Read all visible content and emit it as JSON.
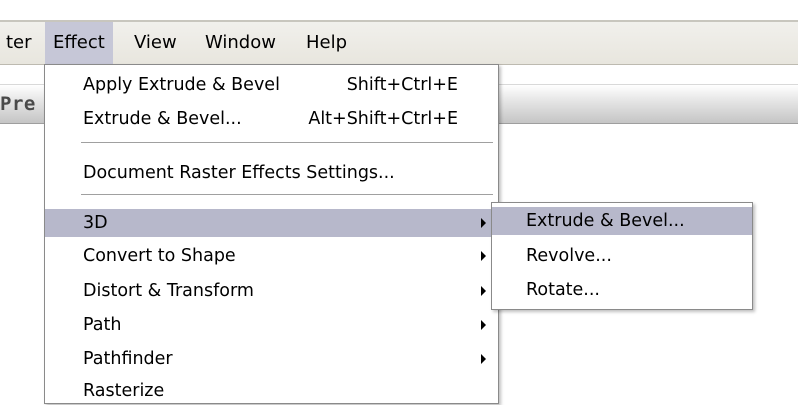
{
  "panel": {
    "title": "Pre"
  },
  "menubar": {
    "items": [
      "ter",
      "Effect",
      "View",
      "Window",
      "Help"
    ]
  },
  "effect_menu": {
    "items": [
      {
        "label": "Apply Extrude & Bevel",
        "shortcut": "Shift+Ctrl+E"
      },
      {
        "label": "Extrude & Bevel...",
        "shortcut": "Alt+Shift+Ctrl+E"
      },
      {
        "label": "Document Raster Effects Settings..."
      },
      {
        "label": "3D",
        "submenu": true,
        "highlighted": true
      },
      {
        "label": "Convert to Shape",
        "submenu": true
      },
      {
        "label": "Distort & Transform",
        "submenu": true
      },
      {
        "label": "Path",
        "submenu": true
      },
      {
        "label": "Pathfinder",
        "submenu": true
      },
      {
        "label": "Rasterize"
      }
    ]
  },
  "submenu_3d": {
    "items": [
      {
        "label": "Extrude & Bevel...",
        "highlighted": true
      },
      {
        "label": "Revolve..."
      },
      {
        "label": "Rotate..."
      }
    ]
  },
  "colors": {
    "menubar_bg": "#ece9d8",
    "active_menu_bg": "#c6c7d7",
    "highlight": "#b7b8cb",
    "menu_border": "#8a8a8a"
  }
}
